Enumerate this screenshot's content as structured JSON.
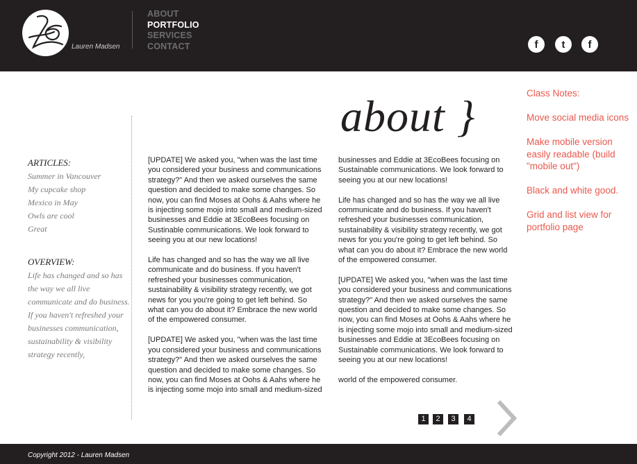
{
  "header": {
    "logo_name": "Lauren Madsen",
    "nav": [
      "ABOUT",
      "PORTFOLIO",
      "SERVICES",
      "CONTACT"
    ],
    "active_nav": "PORTFOLIO",
    "social": [
      {
        "icon": "facebook-icon",
        "glyph": "f"
      },
      {
        "icon": "twitter-icon",
        "glyph": "t"
      },
      {
        "icon": "facebook-icon",
        "glyph": "f"
      }
    ]
  },
  "main": {
    "heading": "about }"
  },
  "sidebar": {
    "articles_heading": "ARTICLES:",
    "articles": [
      "Summer in Vancouver",
      "My cupcake shop",
      "Mexico in May",
      "Owls are cool",
      "Great"
    ],
    "overview_heading": "OVERVIEW:",
    "overview_text": "Life has changed and so has the way we all live communicate and do business. If you haven't refreshed your businesses communication, sustain­ability & visibility strategy recently,"
  },
  "columns": {
    "col1": [
      "[UPDATE] We asked you, \"when was the last time you considered your business and commu­nications strategy?\" And then we asked ourselves the same question and decided to make some changes. So now, you can find Moses at Oohs & Aahs where he is injecting some mojo into small and medium-sized businesses and Eddie at 3EcoBees focusing on Sustinable communications. We look forward to seeing you at our new locations!",
      "Life has changed and so has the way we all live communicate and do business. If you haven't refreshed your businesses communication, sustainability & visibility strategy recently, we got news for you    you're going to get left behind. So what can you do about it? Embrace the new world of the empowered consumer.",
      "[UPDATE] We asked you, \"when was the last time you considered your business and commu­nications strategy?\" And then we asked ourselves the same question and decided to make some changes. So now, you can find Moses at Oohs & Aahs where he is injecting some mojo into small and medium-sized"
    ],
    "col2": [
      "businesses and Eddie at 3EcoBees focusing on Sustainable communications. We look forward to seeing you at our new locations!",
      "Life has changed and so has the way we all live communicate and do business. If you haven't refreshed your businesses communication, sustainability & visibility strategy recently, we got news for you    you're going to get left behind. So what can you do about it? Embrace the new world of the empowered consumer.",
      "[UPDATE] We asked you, \"when was the last time you considered your business and commu­nications strategy?\" And then we asked ourselves the same question and decided to make some changes. So now, you can find Moses at Oohs & Aahs where he is injecting some mojo into small and medium-sized businesses and Eddie at 3EcoBees focusing on Sustainable communications. We look forward to seeing you at our new locations!",
      "world of the empowered consumer."
    ]
  },
  "pagination": {
    "pages": [
      "1",
      "2",
      "3",
      "4"
    ],
    "next_icon": "chevron-right-icon"
  },
  "notes": [
    "Class Notes:",
    "Move social media icons",
    "Make mobile version easily readable (build \"mobile out\")",
    "Black and white good.",
    "Grid and list view for portfolio page"
  ],
  "footer": {
    "copyright": "Copyright 2012 - Lauren Madsen"
  },
  "colors": {
    "header_bg": "#231f20",
    "notes_red": "#e8584d",
    "nav_inactive": "#6d6d6d",
    "arrow_gray": "#bdbdbd"
  }
}
